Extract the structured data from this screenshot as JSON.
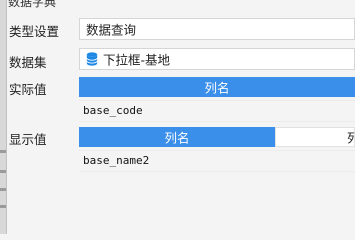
{
  "panel": {
    "title": "数据字典"
  },
  "type_setting": {
    "label": "类型设置",
    "value": "数据查询"
  },
  "dataset": {
    "label": "数据集",
    "value": "下拉框-基地",
    "icon": "database-icon",
    "icon_color": "#1e88e5"
  },
  "actual_value": {
    "label": "实际值",
    "column_header": "列名",
    "column_value": "base_code"
  },
  "display_value": {
    "label": "显示值",
    "column_header": "列名",
    "column_header_2": "列",
    "column_value": "base_name2"
  },
  "colors": {
    "accent": "#3a8fea"
  }
}
